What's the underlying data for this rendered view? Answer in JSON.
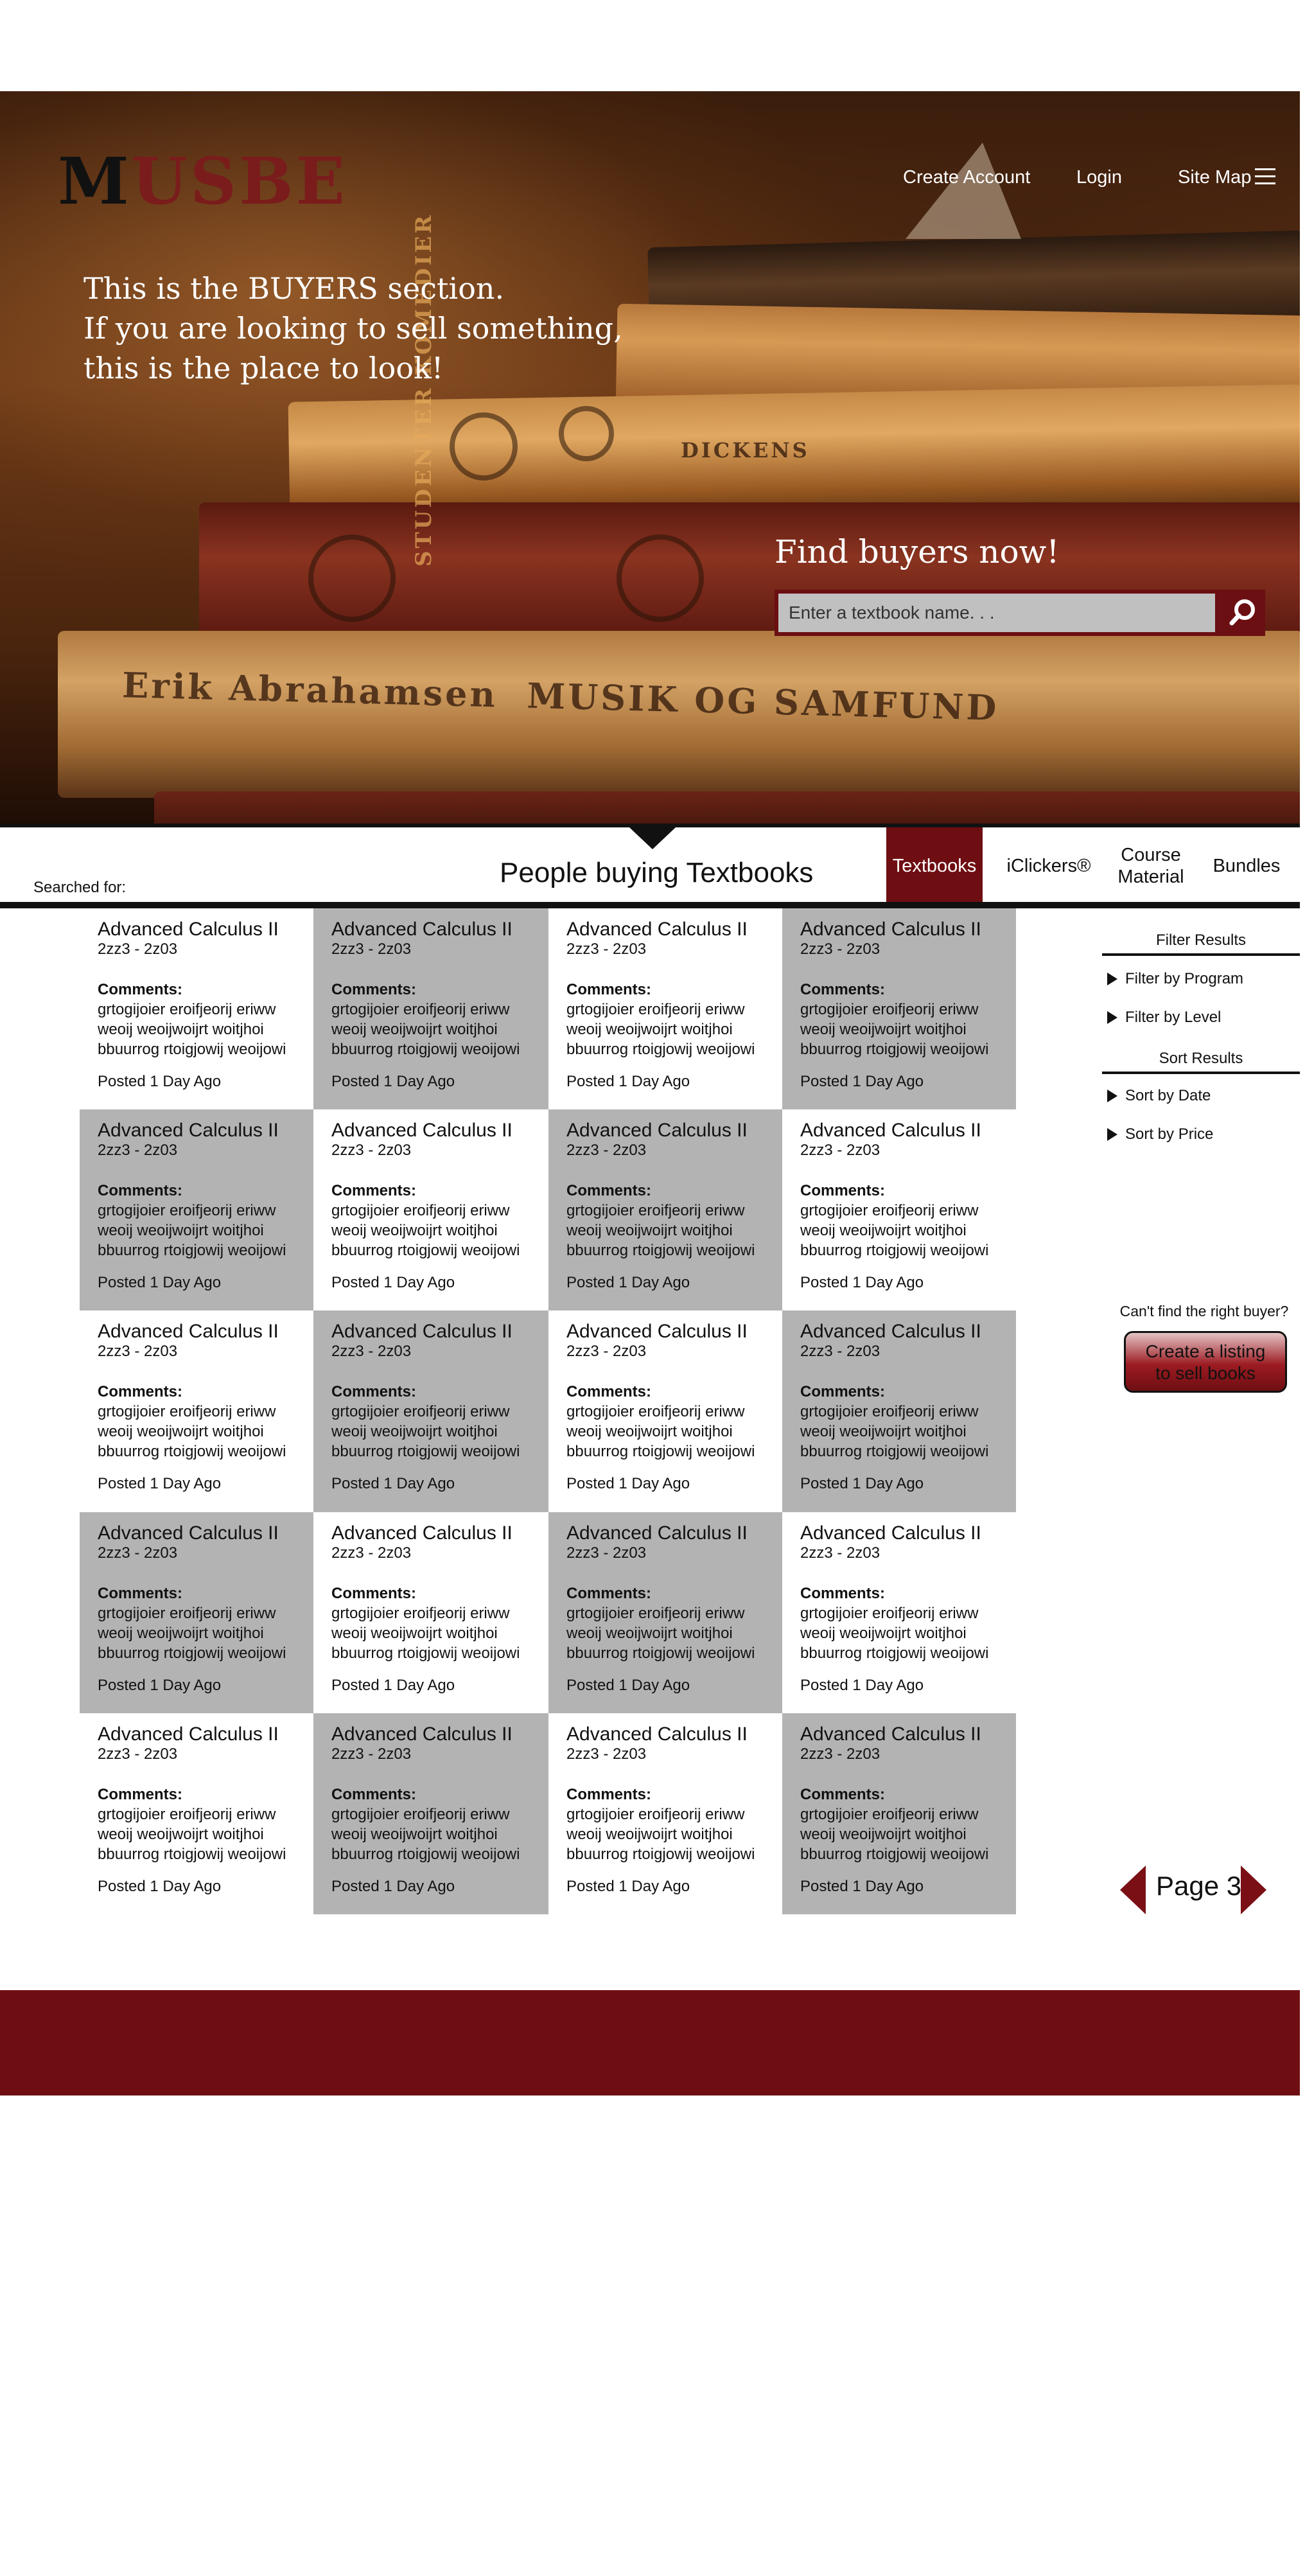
{
  "brand": {
    "logo_first": "M",
    "logo_rest": "USBE"
  },
  "topnav": {
    "create_account": "Create Account",
    "login": "Login",
    "site_map": "Site Map"
  },
  "hero": {
    "tagline": [
      "This is the BUYERS section.",
      "If you are looking to sell something,",
      "this is the place to look!"
    ],
    "spines": [
      "Erik Abrahamsen  MUSIK OG SAMFUND",
      "STUDENTER KOMEDIER",
      "DICKENS"
    ],
    "find_title": "Find buyers now!",
    "search_placeholder": "Enter a textbook name. . ."
  },
  "listing_bar": {
    "searched_for": "Searched for:",
    "heading": "People buying Textbooks",
    "tabs": [
      {
        "label": "Textbooks",
        "active": true
      },
      {
        "label": "iClickers®",
        "active": false
      },
      {
        "label": "Course\nMaterial",
        "active": false
      },
      {
        "label": "Bundles",
        "active": false
      }
    ]
  },
  "listings": {
    "items": [
      {
        "title": "Advanced Calculus II",
        "code": "2zz3 - 2z03",
        "comments_label": "Comments:",
        "comments": "grtogijoier eroifjeorij eriww\nweoij weoijwoijrt woitjhoi\nbbuurrog rtoigjowij weoijowi",
        "posted": "Posted 1 Day Ago",
        "shade": "white"
      },
      {
        "title": "Advanced Calculus II",
        "code": "2zz3 - 2z03",
        "comments_label": "Comments:",
        "comments": "grtogijoier eroifjeorij eriww\nweoij weoijwoijrt woitjhoi\nbbuurrog rtoigjowij weoijowi",
        "posted": "Posted 1 Day Ago",
        "shade": "gray"
      },
      {
        "title": "Advanced Calculus II",
        "code": "2zz3 - 2z03",
        "comments_label": "Comments:",
        "comments": "grtogijoier eroifjeorij eriww\nweoij weoijwoijrt woitjhoi\nbbuurrog rtoigjowij weoijowi",
        "posted": "Posted 1 Day Ago",
        "shade": "white"
      },
      {
        "title": "Advanced Calculus II",
        "code": "2zz3 - 2z03",
        "comments_label": "Comments:",
        "comments": "grtogijoier eroifjeorij eriww\nweoij weoijwoijrt woitjhoi\nbbuurrog rtoigjowij weoijowi",
        "posted": "Posted 1 Day Ago",
        "shade": "gray"
      },
      {
        "title": "Advanced Calculus II",
        "code": "2zz3 - 2z03",
        "comments_label": "Comments:",
        "comments": "grtogijoier eroifjeorij eriww\nweoij weoijwoijrt woitjhoi\nbbuurrog rtoigjowij weoijowi",
        "posted": "Posted 1 Day Ago",
        "shade": "gray"
      },
      {
        "title": "Advanced Calculus II",
        "code": "2zz3 - 2z03",
        "comments_label": "Comments:",
        "comments": "grtogijoier eroifjeorij eriww\nweoij weoijwoijrt woitjhoi\nbbuurrog rtoigjowij weoijowi",
        "posted": "Posted 1 Day Ago",
        "shade": "white"
      },
      {
        "title": "Advanced Calculus II",
        "code": "2zz3 - 2z03",
        "comments_label": "Comments:",
        "comments": "grtogijoier eroifjeorij eriww\nweoij weoijwoijrt woitjhoi\nbbuurrog rtoigjowij weoijowi",
        "posted": "Posted 1 Day Ago",
        "shade": "gray"
      },
      {
        "title": "Advanced Calculus II",
        "code": "2zz3 - 2z03",
        "comments_label": "Comments:",
        "comments": "grtogijoier eroifjeorij eriww\nweoij weoijwoijrt woitjhoi\nbbuurrog rtoigjowij weoijowi",
        "posted": "Posted 1 Day Ago",
        "shade": "white"
      },
      {
        "title": "Advanced Calculus II",
        "code": "2zz3 - 2z03",
        "comments_label": "Comments:",
        "comments": "grtogijoier eroifjeorij eriww\nweoij weoijwoijrt woitjhoi\nbbuurrog rtoigjowij weoijowi",
        "posted": "Posted 1 Day Ago",
        "shade": "white"
      },
      {
        "title": "Advanced Calculus II",
        "code": "2zz3 - 2z03",
        "comments_label": "Comments:",
        "comments": "grtogijoier eroifjeorij eriww\nweoij weoijwoijrt woitjhoi\nbbuurrog rtoigjowij weoijowi",
        "posted": "Posted 1 Day Ago",
        "shade": "gray"
      },
      {
        "title": "Advanced Calculus II",
        "code": "2zz3 - 2z03",
        "comments_label": "Comments:",
        "comments": "grtogijoier eroifjeorij eriww\nweoij weoijwoijrt woitjhoi\nbbuurrog rtoigjowij weoijowi",
        "posted": "Posted 1 Day Ago",
        "shade": "white"
      },
      {
        "title": "Advanced Calculus II",
        "code": "2zz3 - 2z03",
        "comments_label": "Comments:",
        "comments": "grtogijoier eroifjeorij eriww\nweoij weoijwoijrt woitjhoi\nbbuurrog rtoigjowij weoijowi",
        "posted": "Posted 1 Day Ago",
        "shade": "gray"
      },
      {
        "title": "Advanced Calculus II",
        "code": "2zz3 - 2z03",
        "comments_label": "Comments:",
        "comments": "grtogijoier eroifjeorij eriww\nweoij weoijwoijrt woitjhoi\nbbuurrog rtoigjowij weoijowi",
        "posted": "Posted 1 Day Ago",
        "shade": "gray"
      },
      {
        "title": "Advanced Calculus II",
        "code": "2zz3 - 2z03",
        "comments_label": "Comments:",
        "comments": "grtogijoier eroifjeorij eriww\nweoij weoijwoijrt woitjhoi\nbbuurrog rtoigjowij weoijowi",
        "posted": "Posted 1 Day Ago",
        "shade": "white"
      },
      {
        "title": "Advanced Calculus II",
        "code": "2zz3 - 2z03",
        "comments_label": "Comments:",
        "comments": "grtogijoier eroifjeorij eriww\nweoij weoijwoijrt woitjhoi\nbbuurrog rtoigjowij weoijowi",
        "posted": "Posted 1 Day Ago",
        "shade": "gray"
      },
      {
        "title": "Advanced Calculus II",
        "code": "2zz3 - 2z03",
        "comments_label": "Comments:",
        "comments": "grtogijoier eroifjeorij eriww\nweoij weoijwoijrt woitjhoi\nbbuurrog rtoigjowij weoijowi",
        "posted": "Posted 1 Day Ago",
        "shade": "white"
      },
      {
        "title": "Advanced Calculus II",
        "code": "2zz3 - 2z03",
        "comments_label": "Comments:",
        "comments": "grtogijoier eroifjeorij eriww\nweoij weoijwoijrt woitjhoi\nbbuurrog rtoigjowij weoijowi",
        "posted": "Posted 1 Day Ago",
        "shade": "white"
      },
      {
        "title": "Advanced Calculus II",
        "code": "2zz3 - 2z03",
        "comments_label": "Comments:",
        "comments": "grtogijoier eroifjeorij eriww\nweoij weoijwoijrt woitjhoi\nbbuurrog rtoigjowij weoijowi",
        "posted": "Posted 1 Day Ago",
        "shade": "gray"
      },
      {
        "title": "Advanced Calculus II",
        "code": "2zz3 - 2z03",
        "comments_label": "Comments:",
        "comments": "grtogijoier eroifjeorij eriww\nweoij weoijwoijrt woitjhoi\nbbuurrog rtoigjowij weoijowi",
        "posted": "Posted 1 Day Ago",
        "shade": "white"
      },
      {
        "title": "Advanced Calculus II",
        "code": "2zz3 - 2z03",
        "comments_label": "Comments:",
        "comments": "grtogijoier eroifjeorij eriww\nweoij weoijwoijrt woitjhoi\nbbuurrog rtoigjowij weoijowi",
        "posted": "Posted 1 Day Ago",
        "shade": "gray"
      }
    ]
  },
  "sidebar": {
    "filter_heading": "Filter Results",
    "filter_program": "Filter by Program",
    "filter_level": "Filter by Level",
    "sort_heading": "Sort Results",
    "sort_date": "Sort by Date",
    "sort_price": "Sort by Price",
    "cant_find": "Can't find the right buyer?",
    "create_listing": "Create a listing\nto sell books"
  },
  "pagination": {
    "label": "Page 3"
  },
  "colors": {
    "accent": "#6e0e12",
    "card_gray": "#b3b3b3",
    "logo_red": "#7a1c1c"
  },
  "icons": {
    "search": "search-icon",
    "menu": "hamburger-icon",
    "prev": "chevron-left-icon",
    "next": "chevron-right-icon"
  }
}
